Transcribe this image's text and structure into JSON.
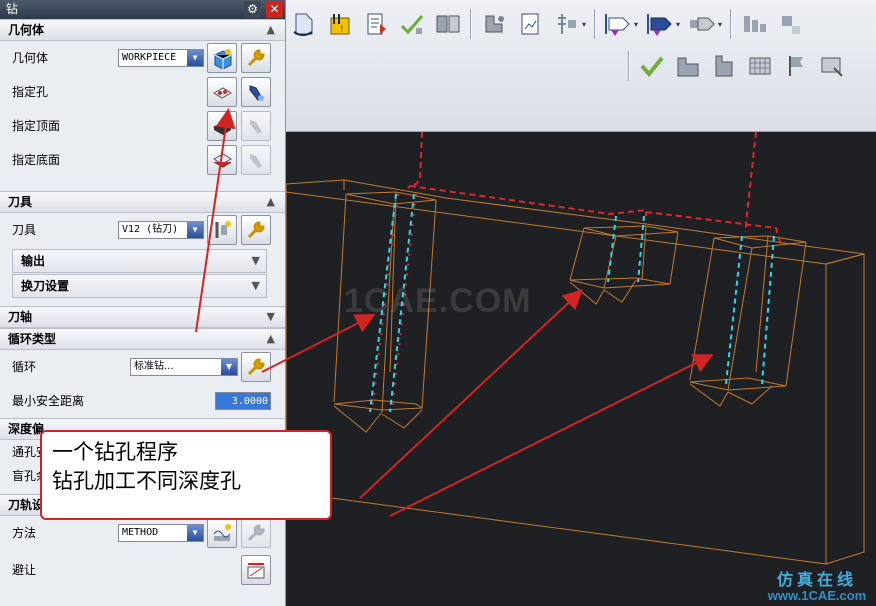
{
  "dialog": {
    "title": "钻",
    "geometry": {
      "header": "几何体",
      "geometry_label": "几何体",
      "geometry_value": "WORKPIECE",
      "specify_holes_label": "指定孔",
      "specify_top_label": "指定顶面",
      "specify_bottom_label": "指定底面"
    },
    "tool": {
      "header": "刀具",
      "tool_label": "刀具",
      "tool_value": "V12 (钻刀)",
      "output_label": "输出",
      "tool_change_label": "换刀设置"
    },
    "tool_axis": {
      "header": "刀轴"
    },
    "cycle": {
      "header": "循环类型",
      "cycle_label": "循环",
      "cycle_value": "标准钻...",
      "min_clearance_label": "最小安全距离",
      "min_clearance_value": "3.0000"
    },
    "depth": {
      "header": "深度偏",
      "through_label": "通孔安",
      "blind_label": "盲孔余"
    },
    "path": {
      "header": "刀轨设",
      "method_label": "方法",
      "method_value": "METHOD",
      "avoid_label": "避让"
    }
  },
  "annotation": {
    "line1": "一个钻孔程序",
    "line2": "钻孔加工不同深度孔",
    "color": "#d32424"
  },
  "viewport": {
    "watermark": "1CAE.COM",
    "brand": "仿真在线",
    "brand_url": "www.1CAE.com",
    "background": "#1f2023",
    "part_color": "#c27a2e",
    "toolpath_color": "#e0262a",
    "axis_color": "#33d6e6"
  }
}
